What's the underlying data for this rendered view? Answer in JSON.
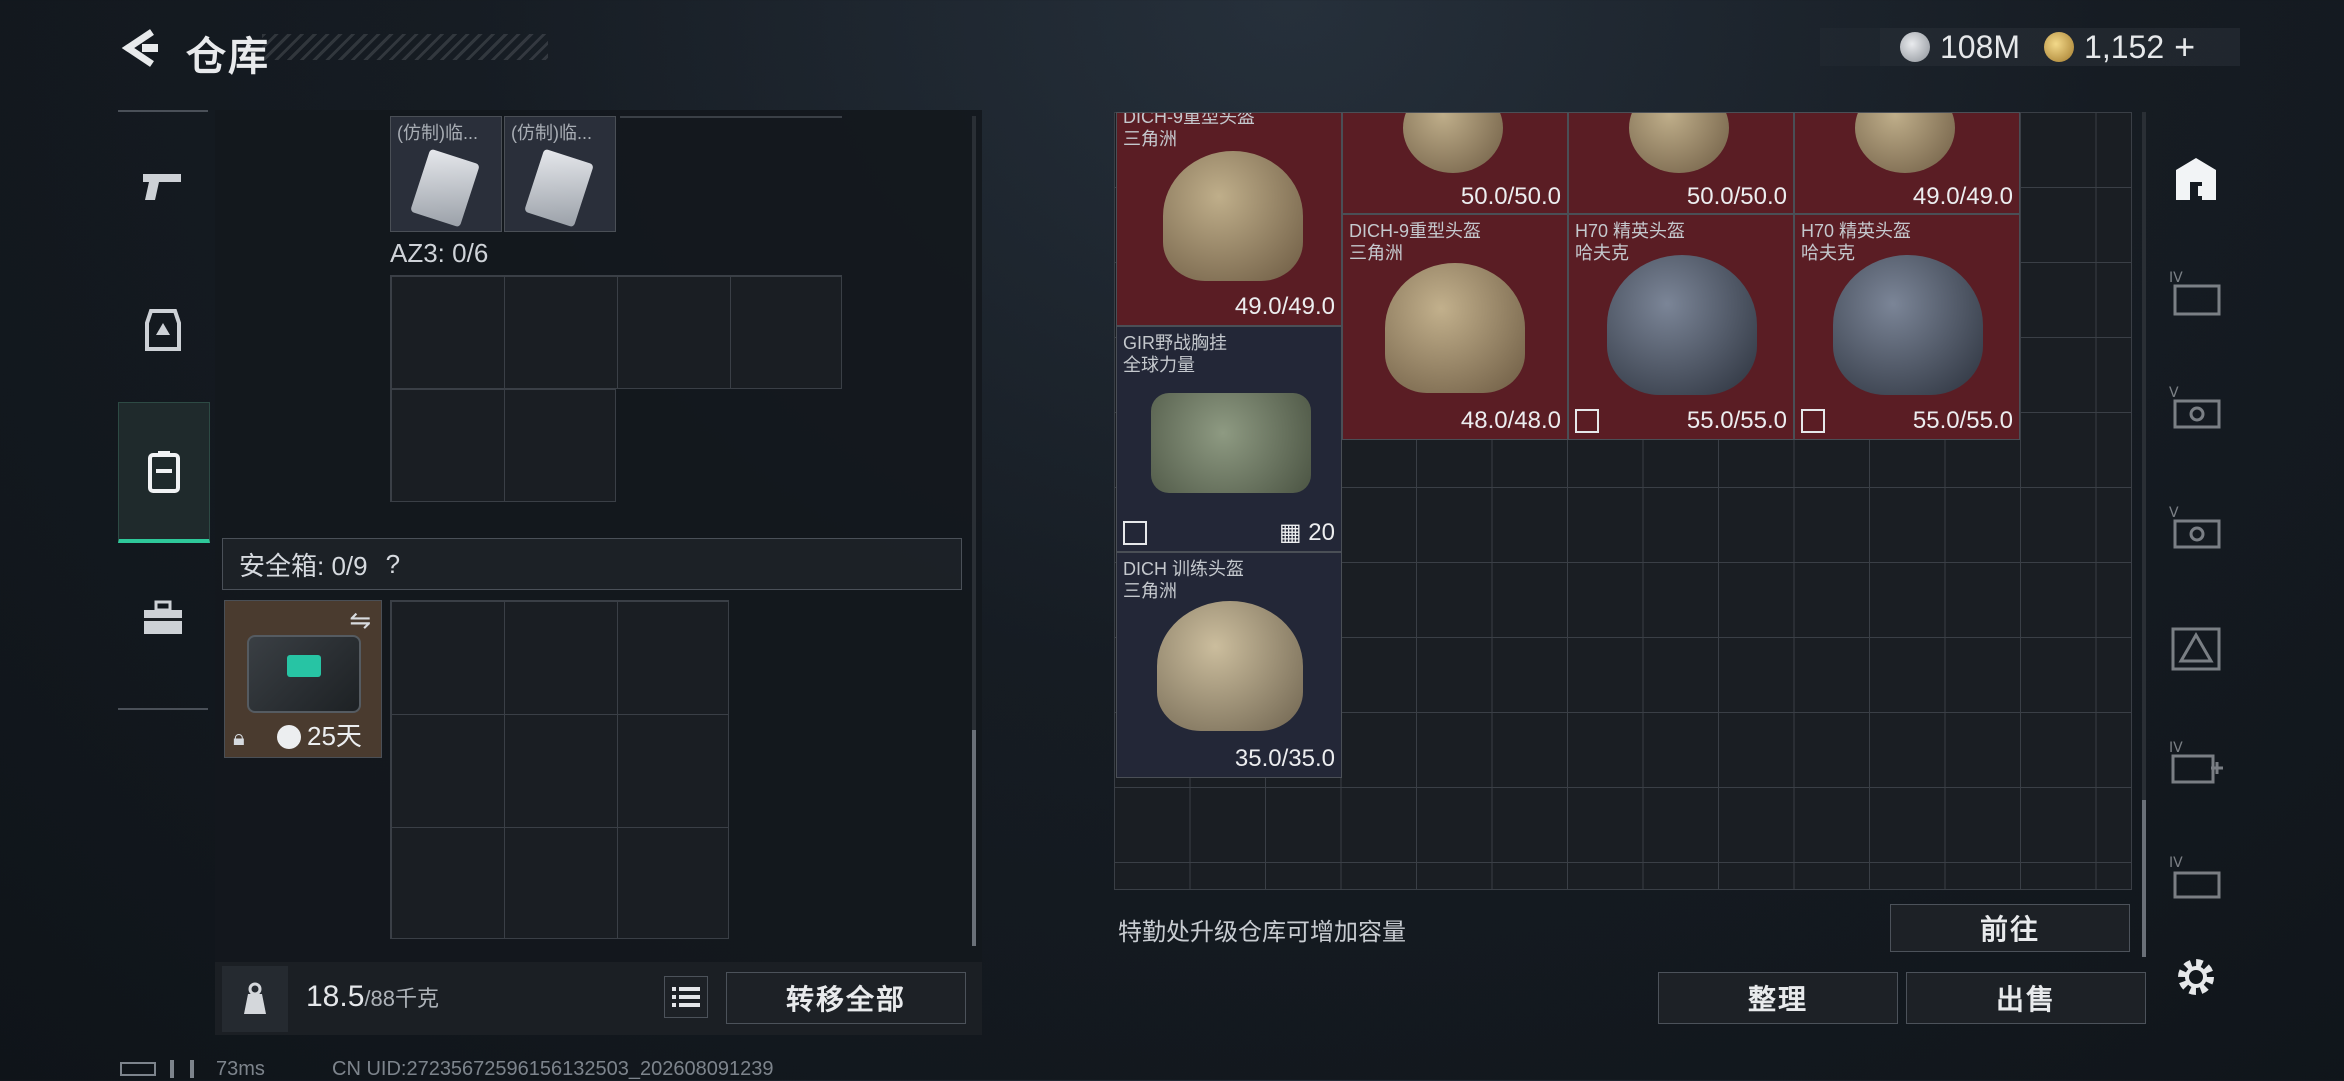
{
  "header": {
    "title": "仓库",
    "currency_silver": "108M",
    "currency_gold": "1,152",
    "add_symbol": "+"
  },
  "side_nav": [
    "weapon",
    "armor",
    "backpack",
    "toolbox"
  ],
  "left_panel": {
    "top_items": [
      {
        "label": "(仿制)临..."
      },
      {
        "label": "(仿制)临..."
      }
    ],
    "az3_label": "AZ3: 0/6",
    "safe_box": {
      "label": "安全箱: 0/9",
      "help": "?",
      "duration": "25天"
    },
    "weight_current": "18.5",
    "weight_max": "/88千克",
    "transfer_all": "转移全部"
  },
  "stash": {
    "items": [
      {
        "name": "DICH-9重型头盔",
        "brand": "三角洲",
        "durability": "49.0/49.0"
      },
      {
        "name": "",
        "brand": "",
        "durability": "50.0/50.0"
      },
      {
        "name": "",
        "brand": "",
        "durability": "50.0/50.0"
      },
      {
        "name": "",
        "brand": "",
        "durability": "49.0/49.0"
      },
      {
        "name": "DICH-9重型头盔",
        "brand": "三角洲",
        "durability": "48.0/48.0"
      },
      {
        "name": "H70 精英头盔",
        "brand": "哈夫克",
        "durability": "55.0/55.0"
      },
      {
        "name": "H70 精英头盔",
        "brand": "哈夫克",
        "durability": "55.0/55.0"
      },
      {
        "name": "GIR野战胸挂",
        "brand": "全球力量",
        "capacity": "20"
      },
      {
        "name": "DICH 训练头盔",
        "brand": "三角洲",
        "durability": "35.0/35.0"
      }
    ],
    "upgrade_hint": "特勤处升级仓库可增加容量",
    "goto_label": "前往",
    "sort_label": "整理",
    "sell_label": "出售"
  },
  "right_tabs": [
    "home",
    "IV",
    "V",
    "V",
    "triangle",
    "IV",
    "IV"
  ],
  "status_bar": {
    "ping": "73ms",
    "uid": "CN UID:27235672596156132503_202608091239"
  },
  "colors": {
    "accent": "#2ec89a",
    "rare_red": "#5a1d24",
    "navy": "#232737"
  }
}
